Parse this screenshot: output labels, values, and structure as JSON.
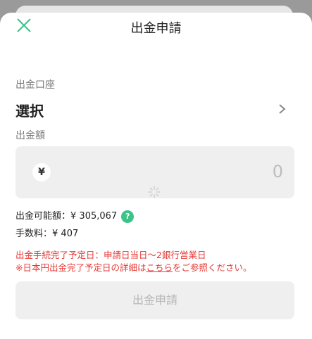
{
  "header": {
    "title": "出金申請",
    "close_icon": "close-icon"
  },
  "account": {
    "label": "出金口座",
    "value": "選択"
  },
  "amount": {
    "label": "出金額",
    "currency_symbol": "¥",
    "value": "0"
  },
  "available": {
    "label": "出金可能額：",
    "value": "¥ 305,067",
    "help": "?"
  },
  "fee": {
    "label": "手数料：",
    "value": "¥ 407"
  },
  "notice": {
    "line1": "出金手続完了予定日：申請日当日〜2銀行営業日",
    "line2_prefix": "※日本円出金完了予定日の詳細は",
    "line2_link": "こちら",
    "line2_suffix": "をご参照ください。"
  },
  "submit": {
    "label": "出金申請"
  },
  "colors": {
    "accent": "#3cc38a",
    "warning": "#e53935",
    "field_bg": "#efefef"
  }
}
